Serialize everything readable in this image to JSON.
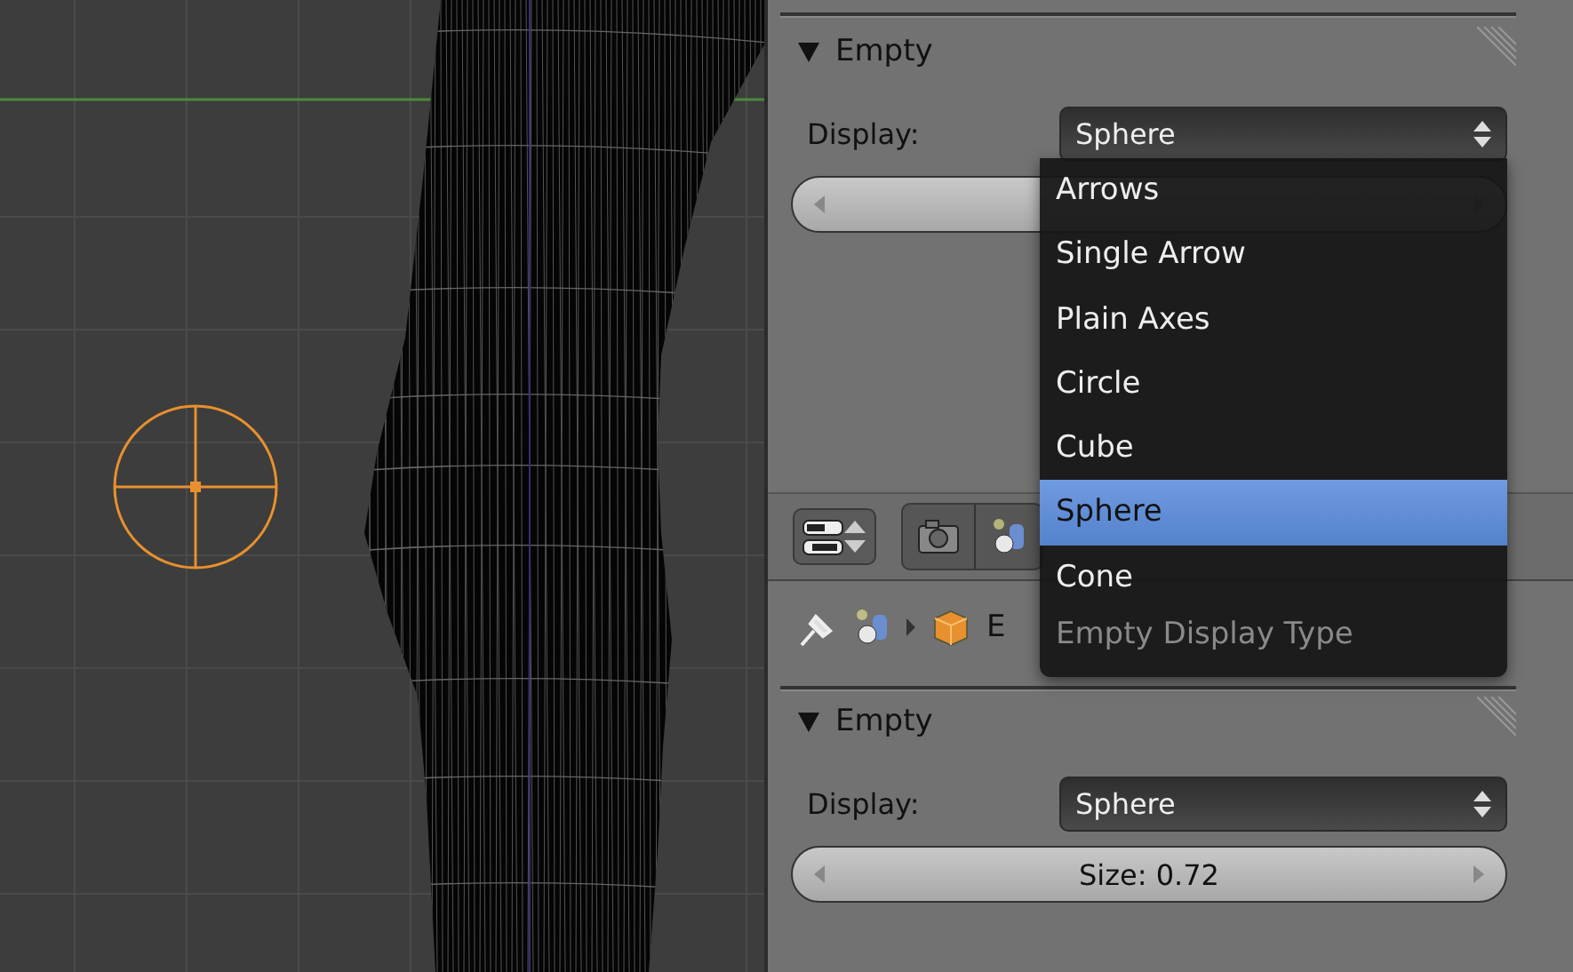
{
  "properties": {
    "panels": [
      {
        "title": "Empty",
        "expanded": true,
        "display_label": "Display:",
        "display_value": "Sphere"
      },
      {
        "title": "Empty",
        "expanded": true,
        "display_label": "Display:",
        "display_value": "Sphere",
        "size_text": "Size: 0.72"
      }
    ],
    "breadcrumb": {
      "label": "E"
    }
  },
  "menu": {
    "title": "Empty Display Type",
    "items": [
      {
        "label": "Arrows",
        "selected": false
      },
      {
        "label": "Single Arrow",
        "selected": false
      },
      {
        "label": "Plain Axes",
        "selected": false
      },
      {
        "label": "Circle",
        "selected": false
      },
      {
        "label": "Cube",
        "selected": false
      },
      {
        "label": "Sphere",
        "selected": true
      },
      {
        "label": "Cone",
        "selected": false
      }
    ]
  }
}
